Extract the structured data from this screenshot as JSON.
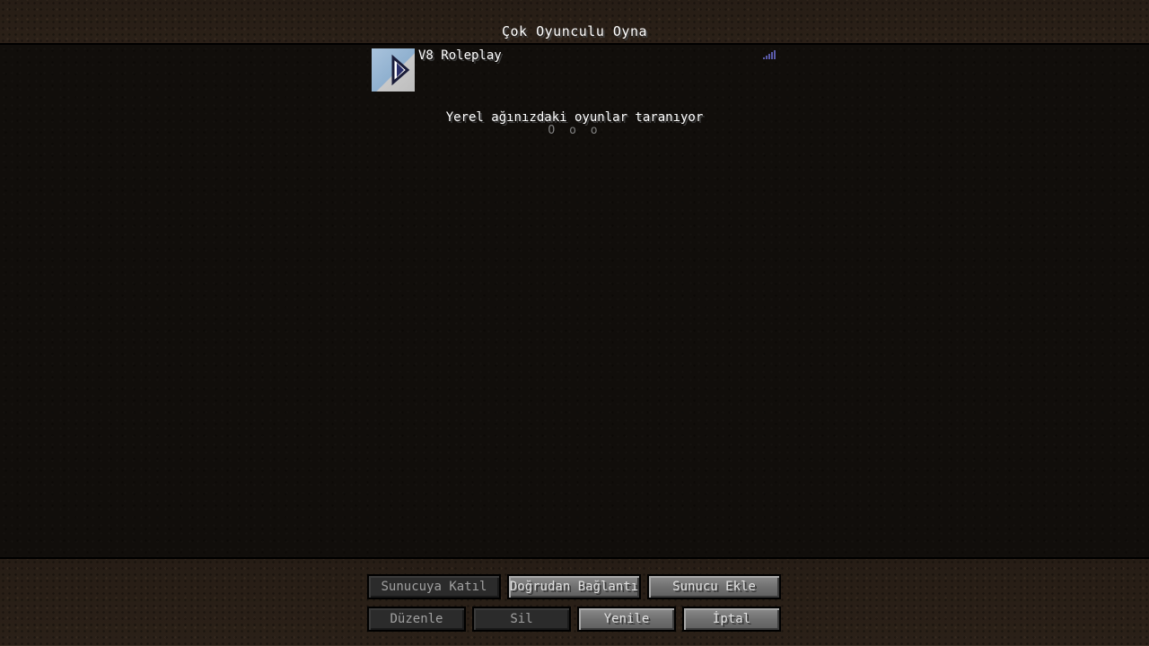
{
  "screen": {
    "title": "Çok Oyunculu Oyna"
  },
  "server_list": {
    "servers": [
      {
        "name": "V8 Roleplay",
        "icon": "play-arrow-icon",
        "signal": "signal-bars-icon"
      }
    ],
    "scan_text": "Yerel ağınızdaki oyunlar taranıyor",
    "scan_dots": "O o o"
  },
  "buttons": {
    "join": "Sunucuya Katıl",
    "direct": "Doğrudan Bağlantı",
    "add": "Sunucu Ekle",
    "edit": "Düzenle",
    "delete": "Sil",
    "refresh": "Yenile",
    "cancel": "İptal"
  },
  "colors": {
    "text": "#ffffff",
    "button": "#707070",
    "button_disabled": "#2b2b2b",
    "dirt": "#2d2219"
  }
}
